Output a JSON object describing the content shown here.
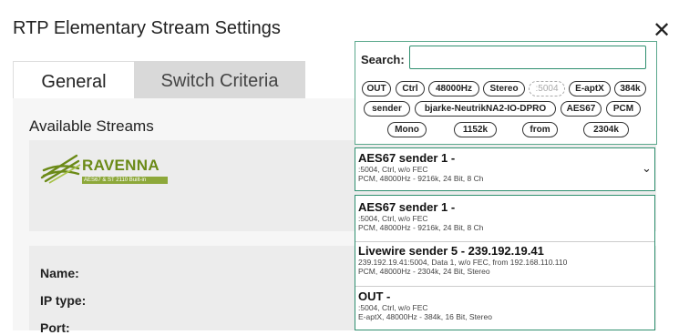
{
  "dialog": {
    "title": "RTP Elementary Stream Settings",
    "close_symbol": "✕"
  },
  "tabs": [
    {
      "label": "General"
    },
    {
      "label": "Switch Criteria"
    }
  ],
  "available_streams_label": "Available Streams",
  "ravenna": {
    "name": "RAVENNA",
    "tagline": "AES67 & ST 2110 Built-in"
  },
  "fields": {
    "name": "Name:",
    "ip_type": "IP type:",
    "port": "Port:"
  },
  "search": {
    "label": "Search:",
    "value": ""
  },
  "chips": [
    {
      "label": "OUT"
    },
    {
      "label": "Ctrl"
    },
    {
      "label": "48000Hz"
    },
    {
      "label": "Stereo"
    },
    {
      "label": ":5004"
    },
    {
      "label": "E-aptX"
    },
    {
      "label": "384k"
    },
    {
      "label": "sender"
    },
    {
      "label": "bjarke-NeutrikNA2-IO-DPRO"
    },
    {
      "label": "AES67"
    },
    {
      "label": "PCM"
    },
    {
      "label": "Mono"
    },
    {
      "label": "1152k"
    },
    {
      "label": "from"
    },
    {
      "label": "2304k"
    }
  ],
  "selected": {
    "title": "AES67 sender 1 -",
    "line1": ":5004, Ctrl, w/o FEC",
    "line2": "PCM, 48000Hz - 9216k, 24 Bit, 8 Ch"
  },
  "options": [
    {
      "title": "AES67 sender 1 -",
      "line1": ":5004, Ctrl, w/o FEC",
      "line2": "PCM, 48000Hz - 9216k, 24 Bit, 8 Ch"
    },
    {
      "title": "Livewire sender 5 - 239.192.19.41",
      "line1": "239.192.19.41:5004, Data 1, w/o FEC, from 192.168.110.110",
      "line2": "PCM, 48000Hz - 2304k, 24 Bit, Stereo"
    },
    {
      "title": "OUT -",
      "line1": ":5004, Ctrl, w/o FEC",
      "line2": "E-aptX, 48000Hz - 384k, 16 Bit, Stereo"
    }
  ],
  "colors": {
    "accent": "#2f8f6f",
    "ravenna_green": "#6b8a17"
  }
}
